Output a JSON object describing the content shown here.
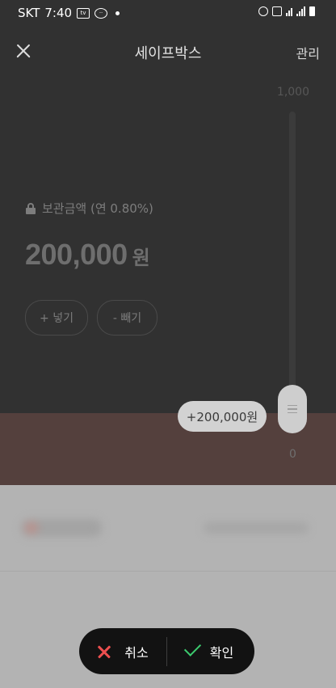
{
  "status_bar": {
    "carrier": "SKT",
    "time": "7:40",
    "left_icons": [
      "tv-app-icon",
      "chat-bubble-icon",
      "dot-indicator"
    ],
    "right_icons": [
      "alarm-icon",
      "mute-icon",
      "wifi-icon",
      "signal-icon",
      "battery-icon"
    ]
  },
  "header": {
    "title": "세이프박스",
    "manage_label": "관리",
    "close_icon": "close-icon"
  },
  "safebox": {
    "rate_label": "보관금액 (연 0.80%)",
    "amount_number": "200,000",
    "amount_unit": "원",
    "deposit_label": "+ 넣기",
    "withdraw_label": "- 빼기"
  },
  "slider": {
    "max_label": "1,000",
    "min_label": "0",
    "tooltip": "+200,000원",
    "level_fraction": 0.06
  },
  "action_bar": {
    "cancel_label": "취소",
    "confirm_label": "확인"
  },
  "colors": {
    "background_dark": "#313131",
    "band": "#54403d",
    "cancel_accent": "#ec4f4f",
    "confirm_accent": "#3ccb6e"
  }
}
